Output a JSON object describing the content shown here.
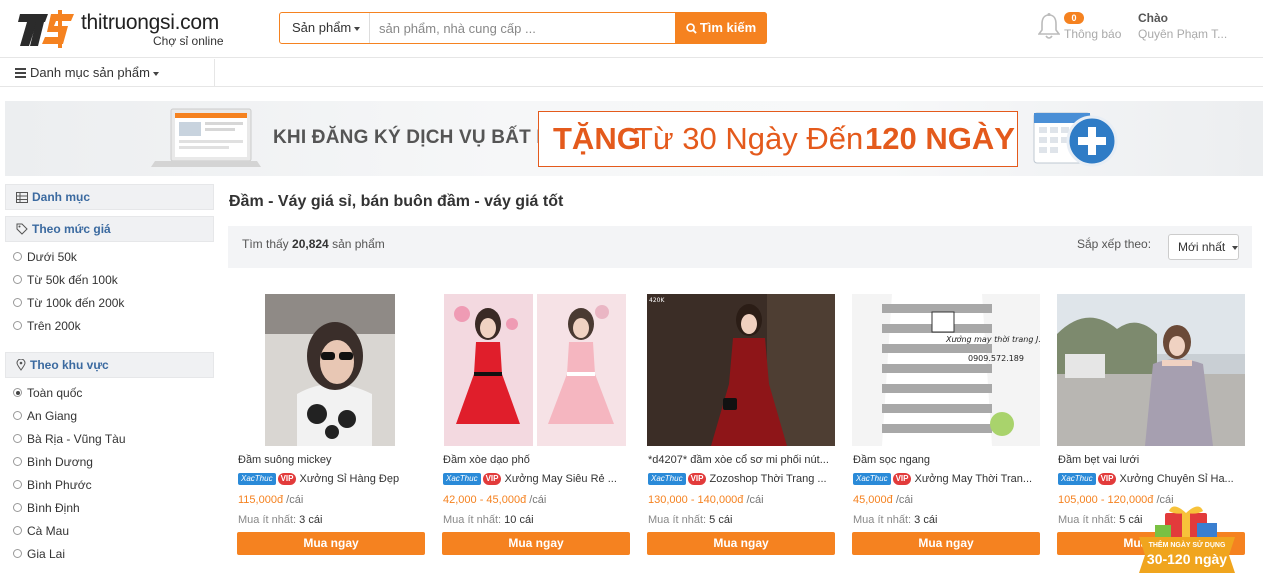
{
  "header": {
    "logo_text": "thitruongsi.com",
    "logo_sub": "Chợ sỉ online",
    "search_category": "Sản phẩm",
    "search_placeholder": "sản phẩm, nhà cung cấp ...",
    "search_button": "Tìm kiếm",
    "notify_count": "0",
    "notify_label": "Thông báo",
    "user_hello": "Chào",
    "user_name": "Quyên Phạm T..."
  },
  "catbar": {
    "label": "Danh mục sản phẩm"
  },
  "banner": {
    "text1": "KHI ĐĂNG KÝ DỊCH VỤ BẤT KỲ",
    "part1": "TẶNG",
    "part2": "Từ 30 Ngày Đến",
    "part3": "120 NGÀY"
  },
  "sidebar": {
    "categories_title": "Danh mục",
    "price_title": "Theo mức giá",
    "price_options": [
      "Dưới 50k",
      "Từ 50k đến 100k",
      "Từ 100k đến 200k",
      "Trên 200k"
    ],
    "region_title": "Theo khu vực",
    "region_options": [
      "Toàn quốc",
      "An Giang",
      "Bà Rịa - Vũng Tàu",
      "Bình Dương",
      "Bình Phước",
      "Bình Định",
      "Cà Mau",
      "Gia Lai"
    ],
    "region_selected": 0
  },
  "main": {
    "title": "Đầm - Váy giá sỉ, bán buôn đầm - váy giá tốt",
    "result_prefix": "Tìm thấy",
    "result_count": "20,824",
    "result_suffix": "sản phẩm",
    "sort_label": "Sắp xếp theo:",
    "sort_value": "Mới nhất"
  },
  "product_labels": {
    "verified": "XacThuc",
    "vip": "VIP",
    "unit": "/cái",
    "min_label": "Mua ít nhất:",
    "buy": "Mua ngay"
  },
  "products": [
    {
      "name": "Đầm suông mickey",
      "seller": "Xưởng Sỉ Hàng Đẹp",
      "price": "115,000đ",
      "min": "3 cái"
    },
    {
      "name": "Đầm xòe dạo phố",
      "seller": "Xưởng May Siêu Rẻ ...",
      "price": "42,000 - 45,000đ",
      "min": "10 cái"
    },
    {
      "name": "*d4207* đầm xòe cổ sơ mi phối nút...",
      "seller": "Zozoshop Thời Trang ...",
      "price": "130,000 - 140,000đ",
      "min": "5 cái",
      "img_label": "420K"
    },
    {
      "name": "Đầm sọc ngang",
      "seller": "Xưởng May Thời Tran...",
      "price": "45,000đ",
      "min": "3 cái",
      "img_label": "Xưởng may thời trang J.K",
      "img_phone": "0909.572.189"
    },
    {
      "name": "Đầm bẹt vai lưới",
      "seller": "Xưởng Chuyên Sỉ Ha...",
      "price": "105,000 - 120,000đ",
      "min": "5 cái"
    }
  ],
  "promo": {
    "top": "THÊM NGÀY SỬ DỤNG",
    "days": "30-120 ngày"
  },
  "colors": {
    "accent": "#f58220",
    "link": "#3b6aa0",
    "banner_red": "#e45a1c"
  }
}
